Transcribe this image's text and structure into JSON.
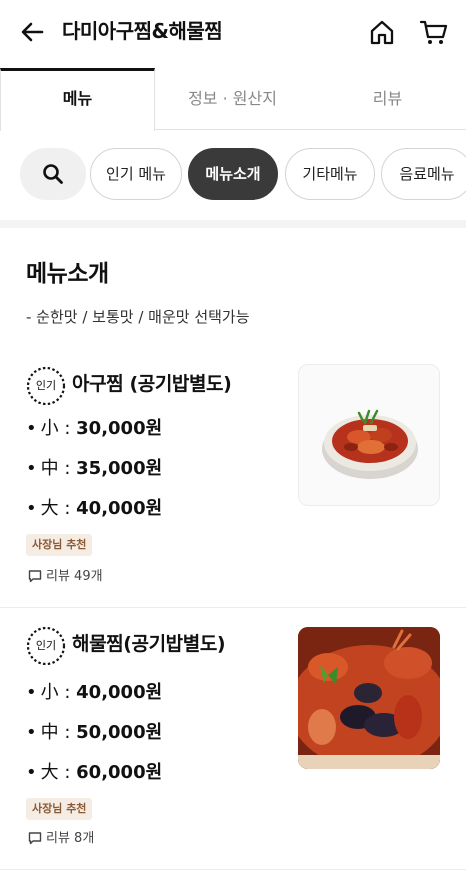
{
  "header": {
    "title": "다미아구찜&해물찜"
  },
  "tabs": [
    {
      "label": "메뉴",
      "active": true
    },
    {
      "label": "정보 · 원산지",
      "active": false
    },
    {
      "label": "리뷰",
      "active": false
    }
  ],
  "chips": [
    {
      "label": "인기 메뉴",
      "active": false
    },
    {
      "label": "메뉴소개",
      "active": true
    },
    {
      "label": "기타메뉴",
      "active": false
    },
    {
      "label": "음료메뉴",
      "active": false
    }
  ],
  "section": {
    "title": "메뉴소개",
    "description": "- 순한맛 / 보통맛 / 매운맛 선택가능"
  },
  "items": [
    {
      "badge": "인기",
      "name": "아구찜 (공기밥별도)",
      "prices": [
        {
          "bullet": "•",
          "size": "小",
          "sep": " : ",
          "price": "30,000원"
        },
        {
          "bullet": "•",
          "size": "中",
          "sep": " : ",
          "price": "35,000원"
        },
        {
          "bullet": "•",
          "size": "大",
          "sep": " : ",
          "price": "40,000원"
        }
      ],
      "tag": "사장님 추천",
      "review": "리뷰 49개"
    },
    {
      "badge": "인기",
      "name": "해물찜(공기밥별도)",
      "prices": [
        {
          "bullet": "•",
          "size": "小",
          "sep": " : ",
          "price": "40,000원"
        },
        {
          "bullet": "•",
          "size": "中",
          "sep": " : ",
          "price": "50,000원"
        },
        {
          "bullet": "•",
          "size": "大",
          "sep": " : ",
          "price": "60,000원"
        }
      ],
      "tag": "사장님 추천",
      "review": "리뷰 8개"
    }
  ],
  "colors": {
    "active_chip": "#3a3a3a",
    "tag_bg": "#f5ece4",
    "tag_text": "#8a5a36"
  },
  "icons": [
    "back-arrow-icon",
    "home-icon",
    "cart-icon",
    "search-icon",
    "popular-badge-icon",
    "comment-icon"
  ]
}
